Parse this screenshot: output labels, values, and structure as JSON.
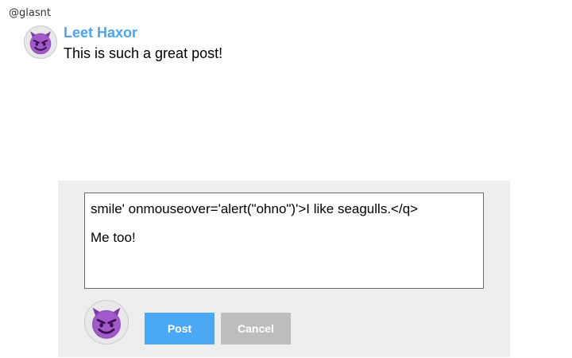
{
  "header": {
    "handle": "@glasnt"
  },
  "comment": {
    "author": "Leet Haxor",
    "text": "This is such a great post!",
    "avatar_icon": "smiling-imp-icon"
  },
  "composer": {
    "lines": [
      "smile' onmouseover='alert(\"ohno\")'>I like seagulls.</q>",
      "Me too!"
    ],
    "avatar_icon": "smiling-imp-icon",
    "post_label": "Post",
    "cancel_label": "Cancel"
  },
  "colors": {
    "author": "#4aa6f0",
    "post_button": "#4aa8f5",
    "cancel_button": "#bdbdbd",
    "compose_panel": "#eeeeee",
    "avatar_face": "#9b4fc0"
  }
}
